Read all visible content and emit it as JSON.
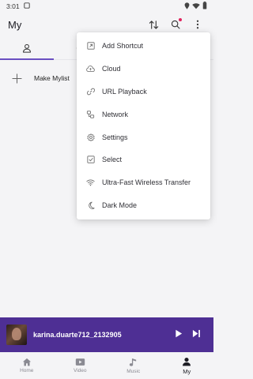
{
  "status_bar": {
    "time": "3:01"
  },
  "header": {
    "title": "My"
  },
  "tabs": [
    {
      "icon": "person-icon",
      "active": true
    },
    {
      "icon": "clock-icon",
      "active": false
    }
  ],
  "mylist": {
    "add_label": "Make Mylist"
  },
  "menu": {
    "items": [
      {
        "label": "Add Shortcut",
        "icon": "shortcut-icon"
      },
      {
        "label": "Cloud",
        "icon": "cloud-icon"
      },
      {
        "label": "URL Playback",
        "icon": "link-icon"
      },
      {
        "label": "Network",
        "icon": "network-icon"
      },
      {
        "label": "Settings",
        "icon": "settings-icon"
      },
      {
        "label": "Select",
        "icon": "checkbox-icon"
      },
      {
        "label": "Ultra-Fast Wireless Transfer",
        "icon": "wifi-icon"
      },
      {
        "label": "Dark Mode",
        "icon": "moon-icon"
      }
    ]
  },
  "player": {
    "title": "karina.duarte712_2132905"
  },
  "bottom_nav": {
    "items": [
      {
        "label": "Home",
        "icon": "home-icon"
      },
      {
        "label": "Video",
        "icon": "video-icon"
      },
      {
        "label": "Music",
        "icon": "music-note-icon"
      },
      {
        "label": "My",
        "icon": "person-icon",
        "active": true
      }
    ]
  },
  "colors": {
    "accent": "#6a4fc1",
    "player_bg": "#4e2f94",
    "notification_dot": "#e0245e",
    "background": "#f4f4f6"
  }
}
